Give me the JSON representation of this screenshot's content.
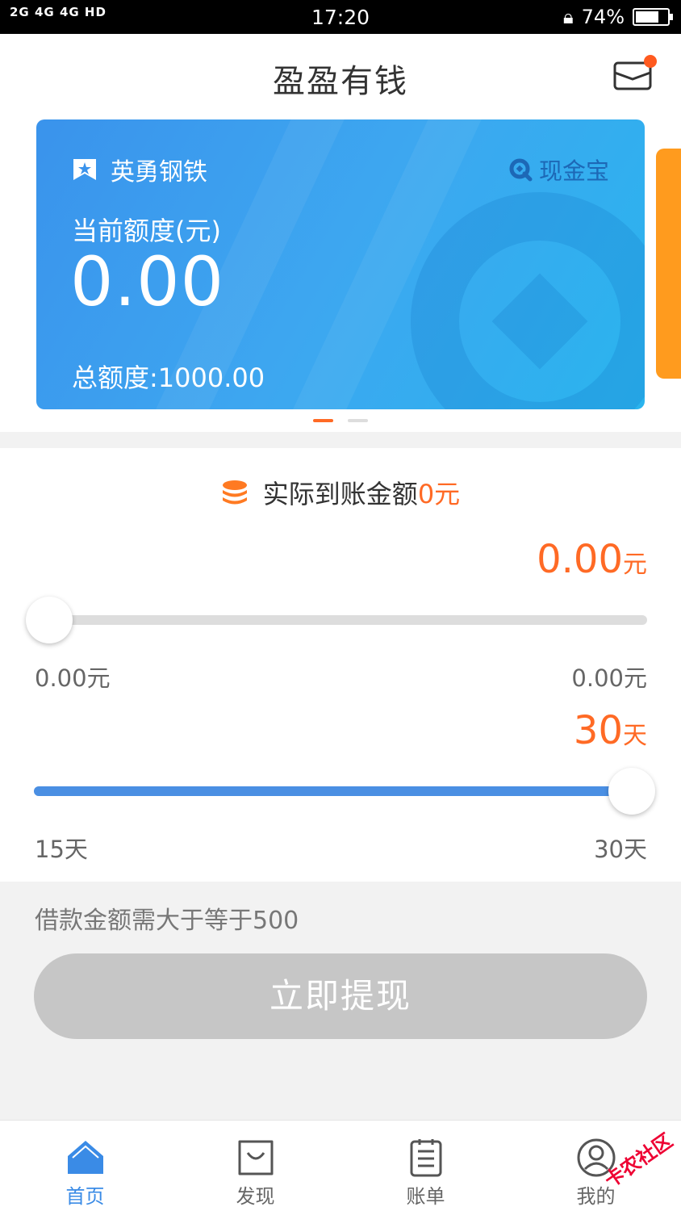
{
  "status_bar": {
    "network": "2G 4G 4G HD",
    "time": "17:20",
    "battery": "74%",
    "battery_level": 0.74
  },
  "header": {
    "title": "盈盈有钱"
  },
  "card": {
    "company": "英勇钢铁",
    "brand": "现金宝",
    "credit_label": "当前额度(元)",
    "credit_value": "0.00",
    "total_label": "总额度:1000.00"
  },
  "carousel": {
    "pages": 2,
    "active_page": 1
  },
  "withdraw": {
    "arrive_label": "实际到账金额",
    "arrive_value": "0元",
    "amount_value": "0.00",
    "amount_unit": "元",
    "amount_fraction": 0.0,
    "amount_min": "0.00元",
    "amount_max": "0.00元",
    "days_value": "30",
    "days_unit": "天",
    "days_fraction": 1.0,
    "days_min": "15天",
    "days_max": "30天"
  },
  "note": "借款金额需大于等于500",
  "submit_label": "立即提现",
  "tabs": [
    {
      "label": "首页",
      "icon": "home-icon",
      "active": true
    },
    {
      "label": "发现",
      "icon": "bag-icon",
      "active": false
    },
    {
      "label": "账单",
      "icon": "bill-icon",
      "active": false
    },
    {
      "label": "我的",
      "icon": "user-icon",
      "active": false
    }
  ],
  "watermark": "卡农社区",
  "colors": {
    "accent": "#ff6a25",
    "primary": "#3a8be6",
    "card": "#3a9cef",
    "disabled": "#c6c6c6"
  }
}
